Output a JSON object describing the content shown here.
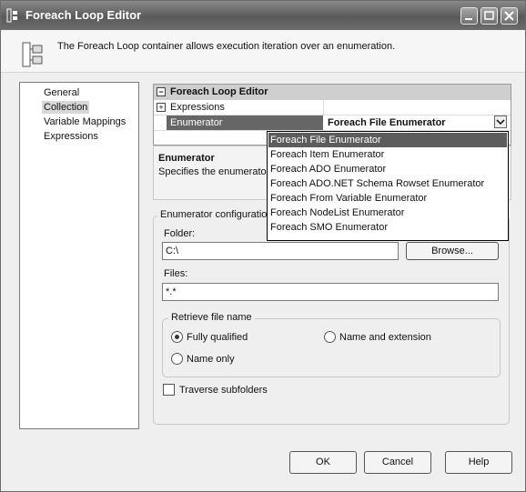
{
  "window": {
    "title": "Foreach Loop Editor"
  },
  "header": {
    "description": "The Foreach Loop container allows execution iteration over an enumeration."
  },
  "nav": {
    "items": [
      {
        "label": "General",
        "selected": false
      },
      {
        "label": "Collection",
        "selected": true
      },
      {
        "label": "Variable Mappings",
        "selected": false
      },
      {
        "label": "Expressions",
        "selected": false
      }
    ]
  },
  "propgrid": {
    "header": "Foreach Loop Editor",
    "rows": [
      {
        "name": "Expressions",
        "value": ""
      },
      {
        "name": "Enumerator",
        "value": "Foreach File Enumerator"
      }
    ]
  },
  "description": {
    "title": "Enumerator",
    "text": "Specifies the enumerator"
  },
  "config": {
    "group_label": "Enumerator configuration",
    "folder_label": "Folder:",
    "folder_value": "C:\\",
    "browse_label": "Browse...",
    "files_label": "Files:",
    "files_value": "*.*",
    "retrieve_label": "Retrieve file name",
    "radio_fully": "Fully qualified",
    "radio_name_ext": "Name and extension",
    "radio_name_only": "Name only",
    "selected_radio": "Fully qualified",
    "traverse_label": "Traverse subfolders",
    "traverse_checked": false
  },
  "dropdown": {
    "options": [
      "Foreach File Enumerator",
      "Foreach Item Enumerator",
      "Foreach ADO Enumerator",
      "Foreach ADO.NET Schema Rowset Enumerator",
      "Foreach From Variable Enumerator",
      "Foreach NodeList Enumerator",
      "Foreach SMO Enumerator"
    ],
    "selected": "Foreach File Enumerator"
  },
  "buttons": {
    "ok": "OK",
    "cancel": "Cancel",
    "help": "Help"
  }
}
